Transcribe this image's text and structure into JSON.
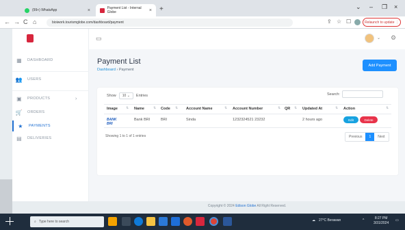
{
  "browser": {
    "tabs": [
      {
        "label": "(99+) WhatsApp",
        "close": "×"
      },
      {
        "label": "Payment List - Internal Globe",
        "close": "×"
      }
    ],
    "new_tab": "+",
    "window_controls": [
      "⌄",
      "–",
      "❐",
      "×"
    ],
    "nav": [
      "←",
      "→",
      "C",
      "⌂"
    ],
    "url": "bioiwork.tourismglobe.com/dashboard/payment",
    "relaunch_label": "Relaunch to update ⋮",
    "address_icons": [
      "⇪",
      "☆",
      "☐"
    ]
  },
  "sidebar": {
    "items": [
      {
        "label": "DASHBOARD",
        "icon": "grid-icon",
        "glyph": "▦"
      },
      {
        "label": "USERS",
        "icon": "users-icon",
        "glyph": "👥"
      },
      {
        "label": "PRODUCTS",
        "icon": "products-icon",
        "glyph": "▣",
        "chevron": "›"
      },
      {
        "label": "ORDERS",
        "icon": "cart-icon",
        "glyph": "🛒"
      },
      {
        "label": "PAYMENTS",
        "icon": "star-icon",
        "glyph": "★"
      },
      {
        "label": "DELIVERIES",
        "icon": "truck-icon",
        "glyph": "▤"
      }
    ],
    "active_color": "#1f6fd1"
  },
  "topbar": {
    "menu_icon": "▭",
    "profile_chevron": "⌄",
    "gear": "⚙"
  },
  "page": {
    "title": "Payment List",
    "breadcrumb_home": "Dashboard",
    "breadcrumb_sep": "›",
    "breadcrumb_current": "Payment",
    "add_button": "Add Payment"
  },
  "table": {
    "show_label": "Show",
    "entries_value": "10",
    "entries_label": "Entries",
    "search_label": "Search:",
    "columns": [
      "Image",
      "Name",
      "Code",
      "Account Name",
      "Account Number",
      "QR",
      "Updated At",
      "Action"
    ],
    "rows": [
      {
        "image_text": "BANK BRI",
        "name": "Bank BRI",
        "code": "BRI",
        "account_name": "Sinda",
        "account_number": "1232324521 23232",
        "qr": "",
        "updated_at": "2 hours ago",
        "edit_label": "Edit",
        "delete_label": "Delete"
      }
    ],
    "showing": "Showing 1 to 1 of 1 entries",
    "pager": [
      "Previous",
      "1",
      "Next"
    ]
  },
  "footer": {
    "prefix": "Copyright © 2024",
    "brand": "Edison Globe",
    "suffix": "All Right Reserved."
  },
  "taskbar": {
    "search_placeholder": "Type here to search",
    "weather": "27°C Berawan",
    "time": "8:27 PM",
    "date": "3/31/2024"
  }
}
